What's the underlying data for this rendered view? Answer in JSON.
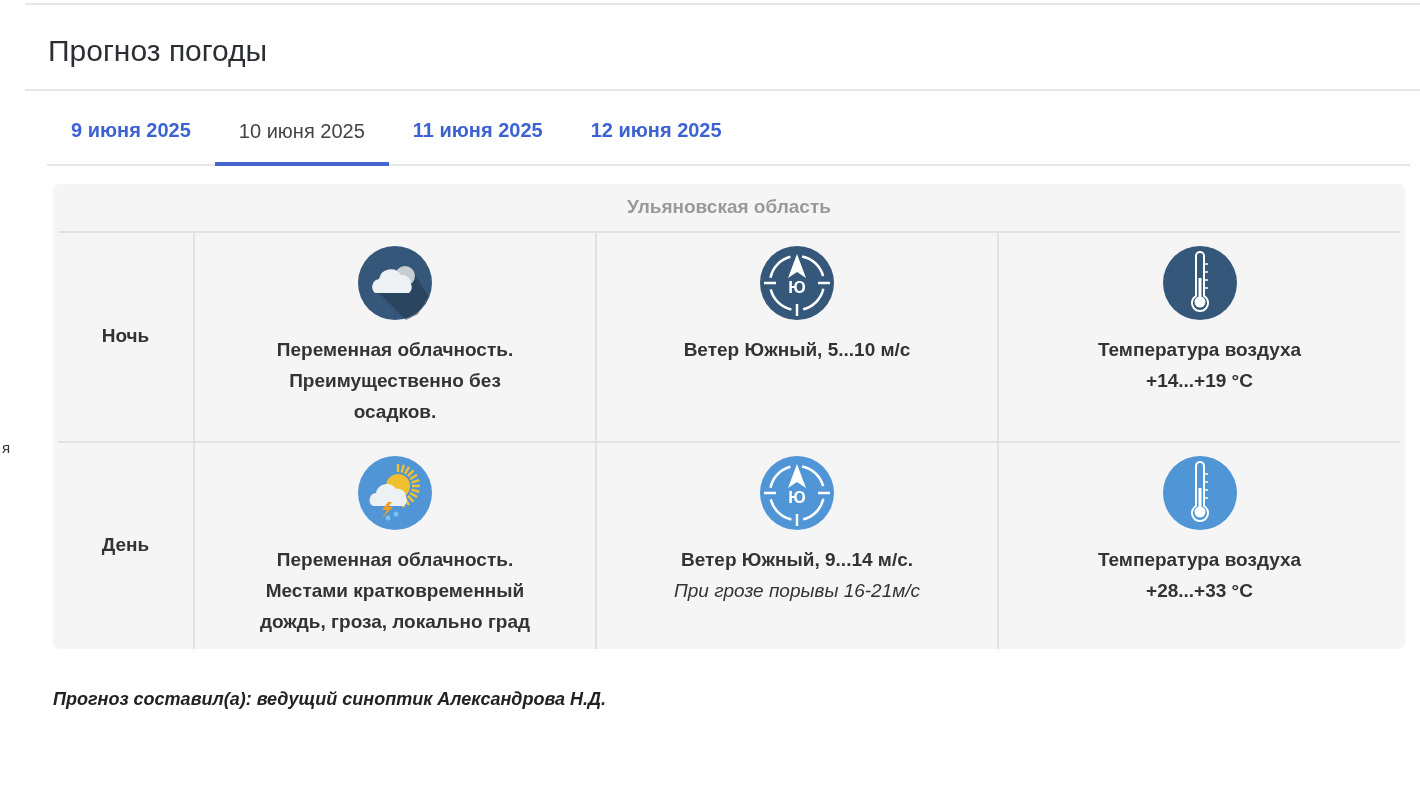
{
  "sidebar_fragment": "я",
  "title": "Прогноз погоды",
  "tabs": [
    {
      "label": "9 июня 2025",
      "selected": false
    },
    {
      "label": "10 июня 2025",
      "selected": true
    },
    {
      "label": "11 июня 2025",
      "selected": false
    },
    {
      "label": "12 июня 2025",
      "selected": false
    }
  ],
  "table": {
    "region": "Ульяновская область",
    "rows": [
      {
        "kind": "night",
        "period": "Ночь",
        "weather": [
          "Переменная облачность.",
          "Преимущественно без",
          "осадков."
        ],
        "wind_badge": "Ю",
        "wind": "Ветер Южный, 5...10 м/с",
        "temperature": [
          "Температура воздуха",
          "+14...+19 °С"
        ]
      },
      {
        "kind": "day",
        "period": "День",
        "weather": [
          "Переменная облачность.",
          "Местами кратковременный",
          "дождь, гроза, локально град"
        ],
        "wind_badge": "Ю",
        "wind": "Ветер Южный, 9...14 м/с.",
        "wind_note": "При грозе порывы 16-21м/с",
        "temperature": [
          "Температура воздуха",
          "+28...+33 °С"
        ]
      }
    ]
  },
  "footer": "Прогноз составил(а): ведущий синоптик Александрова Н.Д."
}
